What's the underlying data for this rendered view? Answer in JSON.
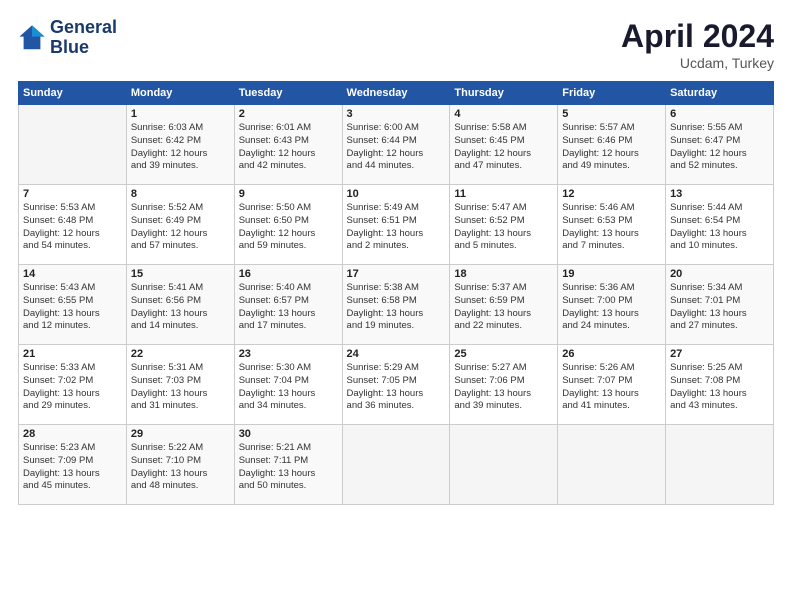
{
  "header": {
    "logo_line1": "General",
    "logo_line2": "Blue",
    "month": "April 2024",
    "location": "Ucdam, Turkey"
  },
  "weekdays": [
    "Sunday",
    "Monday",
    "Tuesday",
    "Wednesday",
    "Thursday",
    "Friday",
    "Saturday"
  ],
  "weeks": [
    [
      {
        "day": "",
        "info": ""
      },
      {
        "day": "1",
        "info": "Sunrise: 6:03 AM\nSunset: 6:42 PM\nDaylight: 12 hours\nand 39 minutes."
      },
      {
        "day": "2",
        "info": "Sunrise: 6:01 AM\nSunset: 6:43 PM\nDaylight: 12 hours\nand 42 minutes."
      },
      {
        "day": "3",
        "info": "Sunrise: 6:00 AM\nSunset: 6:44 PM\nDaylight: 12 hours\nand 44 minutes."
      },
      {
        "day": "4",
        "info": "Sunrise: 5:58 AM\nSunset: 6:45 PM\nDaylight: 12 hours\nand 47 minutes."
      },
      {
        "day": "5",
        "info": "Sunrise: 5:57 AM\nSunset: 6:46 PM\nDaylight: 12 hours\nand 49 minutes."
      },
      {
        "day": "6",
        "info": "Sunrise: 5:55 AM\nSunset: 6:47 PM\nDaylight: 12 hours\nand 52 minutes."
      }
    ],
    [
      {
        "day": "7",
        "info": "Sunrise: 5:53 AM\nSunset: 6:48 PM\nDaylight: 12 hours\nand 54 minutes."
      },
      {
        "day": "8",
        "info": "Sunrise: 5:52 AM\nSunset: 6:49 PM\nDaylight: 12 hours\nand 57 minutes."
      },
      {
        "day": "9",
        "info": "Sunrise: 5:50 AM\nSunset: 6:50 PM\nDaylight: 12 hours\nand 59 minutes."
      },
      {
        "day": "10",
        "info": "Sunrise: 5:49 AM\nSunset: 6:51 PM\nDaylight: 13 hours\nand 2 minutes."
      },
      {
        "day": "11",
        "info": "Sunrise: 5:47 AM\nSunset: 6:52 PM\nDaylight: 13 hours\nand 5 minutes."
      },
      {
        "day": "12",
        "info": "Sunrise: 5:46 AM\nSunset: 6:53 PM\nDaylight: 13 hours\nand 7 minutes."
      },
      {
        "day": "13",
        "info": "Sunrise: 5:44 AM\nSunset: 6:54 PM\nDaylight: 13 hours\nand 10 minutes."
      }
    ],
    [
      {
        "day": "14",
        "info": "Sunrise: 5:43 AM\nSunset: 6:55 PM\nDaylight: 13 hours\nand 12 minutes."
      },
      {
        "day": "15",
        "info": "Sunrise: 5:41 AM\nSunset: 6:56 PM\nDaylight: 13 hours\nand 14 minutes."
      },
      {
        "day": "16",
        "info": "Sunrise: 5:40 AM\nSunset: 6:57 PM\nDaylight: 13 hours\nand 17 minutes."
      },
      {
        "day": "17",
        "info": "Sunrise: 5:38 AM\nSunset: 6:58 PM\nDaylight: 13 hours\nand 19 minutes."
      },
      {
        "day": "18",
        "info": "Sunrise: 5:37 AM\nSunset: 6:59 PM\nDaylight: 13 hours\nand 22 minutes."
      },
      {
        "day": "19",
        "info": "Sunrise: 5:36 AM\nSunset: 7:00 PM\nDaylight: 13 hours\nand 24 minutes."
      },
      {
        "day": "20",
        "info": "Sunrise: 5:34 AM\nSunset: 7:01 PM\nDaylight: 13 hours\nand 27 minutes."
      }
    ],
    [
      {
        "day": "21",
        "info": "Sunrise: 5:33 AM\nSunset: 7:02 PM\nDaylight: 13 hours\nand 29 minutes."
      },
      {
        "day": "22",
        "info": "Sunrise: 5:31 AM\nSunset: 7:03 PM\nDaylight: 13 hours\nand 31 minutes."
      },
      {
        "day": "23",
        "info": "Sunrise: 5:30 AM\nSunset: 7:04 PM\nDaylight: 13 hours\nand 34 minutes."
      },
      {
        "day": "24",
        "info": "Sunrise: 5:29 AM\nSunset: 7:05 PM\nDaylight: 13 hours\nand 36 minutes."
      },
      {
        "day": "25",
        "info": "Sunrise: 5:27 AM\nSunset: 7:06 PM\nDaylight: 13 hours\nand 39 minutes."
      },
      {
        "day": "26",
        "info": "Sunrise: 5:26 AM\nSunset: 7:07 PM\nDaylight: 13 hours\nand 41 minutes."
      },
      {
        "day": "27",
        "info": "Sunrise: 5:25 AM\nSunset: 7:08 PM\nDaylight: 13 hours\nand 43 minutes."
      }
    ],
    [
      {
        "day": "28",
        "info": "Sunrise: 5:23 AM\nSunset: 7:09 PM\nDaylight: 13 hours\nand 45 minutes."
      },
      {
        "day": "29",
        "info": "Sunrise: 5:22 AM\nSunset: 7:10 PM\nDaylight: 13 hours\nand 48 minutes."
      },
      {
        "day": "30",
        "info": "Sunrise: 5:21 AM\nSunset: 7:11 PM\nDaylight: 13 hours\nand 50 minutes."
      },
      {
        "day": "",
        "info": ""
      },
      {
        "day": "",
        "info": ""
      },
      {
        "day": "",
        "info": ""
      },
      {
        "day": "",
        "info": ""
      }
    ]
  ]
}
